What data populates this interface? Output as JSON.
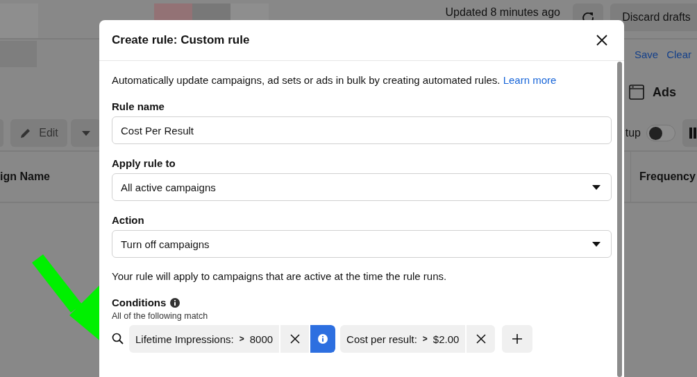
{
  "background": {
    "updated": "Updated 8 minutes ago",
    "discard_button": "Discard drafts",
    "save_link": "Save",
    "clear_link": "Clear",
    "ads_label": "Ads",
    "edit_button": "Edit",
    "toggle_label": "tup",
    "toggle": {
      "on": false
    },
    "column_1": "ign Name",
    "column_2": "Frequency"
  },
  "dialog": {
    "title": "Create rule: Custom rule",
    "description": "Automatically update campaigns, ad sets or ads in bulk by creating automated rules.",
    "learn_more": "Learn more",
    "fields": [
      {
        "label": "Rule name",
        "kind": "text",
        "value": "Cost Per Result"
      },
      {
        "label": "Apply rule to",
        "kind": "select",
        "value": "All active campaigns"
      },
      {
        "label": "Action",
        "kind": "select",
        "value": "Turn off campaigns"
      }
    ],
    "note": "Your rule will apply to campaigns that are active at the time the rule runs.",
    "conditions": {
      "title": "Conditions",
      "subtitle": "All of the following match",
      "items": [
        {
          "metric": "Lifetime Impressions:",
          "operator": ">",
          "value": "8000",
          "info": true
        },
        {
          "metric": "Cost per result:",
          "operator": ">",
          "value": "$2.00",
          "info": false
        }
      ]
    }
  }
}
